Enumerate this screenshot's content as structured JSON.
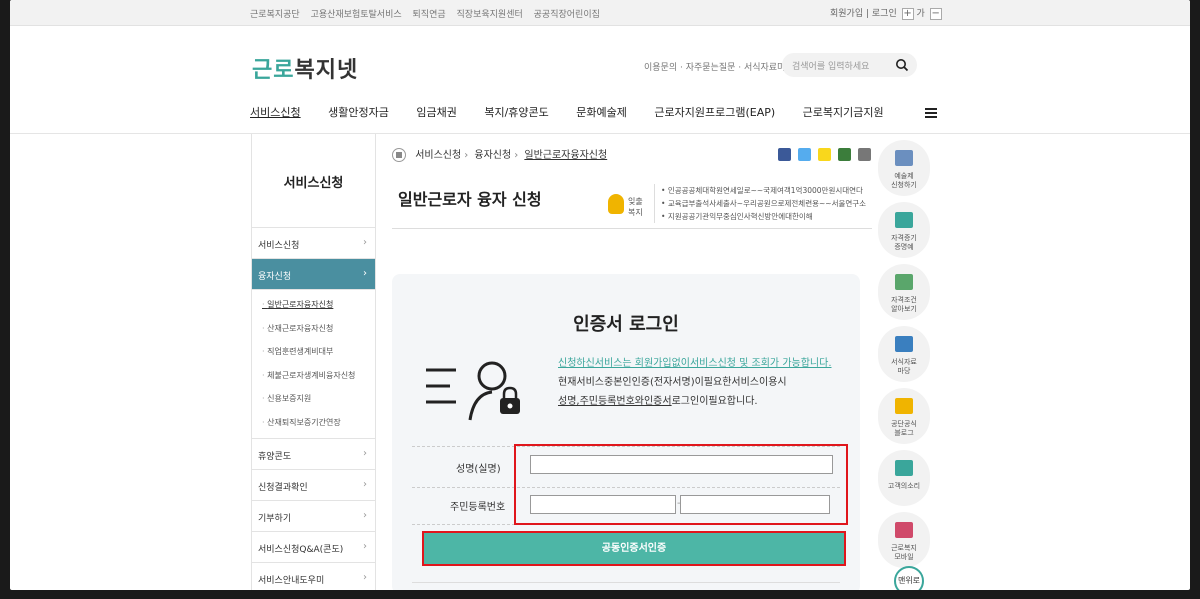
{
  "utilbar": {
    "links": [
      "근로복지공단",
      "고용산재보험토탈서비스",
      "퇴직연금",
      "직장보육지원센터",
      "공공직장어린이집"
    ],
    "login": "회원가입",
    "logout": "로그인",
    "zoom_in": "+",
    "zoom_label": "가",
    "zoom_out": "−"
  },
  "header": {
    "logo_part1": "근로",
    "logo_part2": "복지넷",
    "toplinks": "이용문의 · 자주묻는질문 · 서식자료마당",
    "search_placeholder": "검색어를 입력하세요"
  },
  "gnb": [
    "서비스신청",
    "생활안정자금",
    "임금채권",
    "복지/휴양콘도",
    "문화예술제",
    "근로자지원프로그램(EAP)",
    "근로복지기금지원"
  ],
  "lnb": {
    "title": "서비스신청",
    "items": [
      {
        "label": "서비스신청"
      },
      {
        "label": "융자신청"
      }
    ],
    "subs": [
      "일반근로자융자신청",
      "산재근로자융자신청",
      "직업훈련생계비대부",
      "체불근로자생계비융자신청",
      "신용보증지원",
      "산재퇴직보증기간연장"
    ],
    "items2": [
      "휴양콘도",
      "신청결과확인",
      "기부하기",
      "서비스신청Q&A(콘도)",
      "서비스안내도우미"
    ]
  },
  "breadcrumb": {
    "items": [
      "서비스신청",
      "융자신청",
      "일반근로자융자신청"
    ]
  },
  "page_title": "일반근로자 융자 신청",
  "tips": {
    "label1": "잊출",
    "label2": "복지",
    "lines": [
      "인공공공체대학원연세일로~~국제여객1억3000만원시대연다",
      "교육급부출석사세출사~우리공원으로제전체련용~~서울연구소",
      "지원공공기관익무중심인사혁신방안에대한이해"
    ]
  },
  "login": {
    "title": "인증서 로그인",
    "desc_line1": "신청하신서비스는 회원가입없이서비스신청 및 조회가 가능합니다.",
    "desc_line2": "현재서비스중본인인증(전자서명)이필요한서비스이용시",
    "desc_line3_u": "성명,주민등록번호와인증서",
    "desc_line3_rest": "로그인이필요합니다.",
    "name_label": "성명(실명)",
    "ssn_label": "주민등록번호",
    "ssn_dash": "-",
    "button": "공동인증서인증"
  },
  "quick": [
    {
      "label1": "예술제",
      "label2": "신청하기",
      "icon_color": "#6b8fbf"
    },
    {
      "label1": "자격증기",
      "label2": "증명예",
      "icon_color": "#3aa69b"
    },
    {
      "label1": "자격조건",
      "label2": "알아보기",
      "icon_color": "#5aa66b"
    },
    {
      "label1": "서식자료",
      "label2": "마당",
      "icon_color": "#3a7fbf"
    },
    {
      "label1": "공단공식",
      "label2": "블로그",
      "icon_color": "#f0b400"
    },
    {
      "label1": "고객의소리",
      "label2": "",
      "icon_color": "#3aa69b"
    },
    {
      "label1": "근로복지",
      "label2": "모바일",
      "icon_color": "#d04a6a"
    }
  ],
  "top_button": "맨위로",
  "colors": {
    "brand": "#3aa69b",
    "button": "#4db6a6",
    "lnb_active": "#4a8fa0",
    "highlight": "#e0161c"
  }
}
